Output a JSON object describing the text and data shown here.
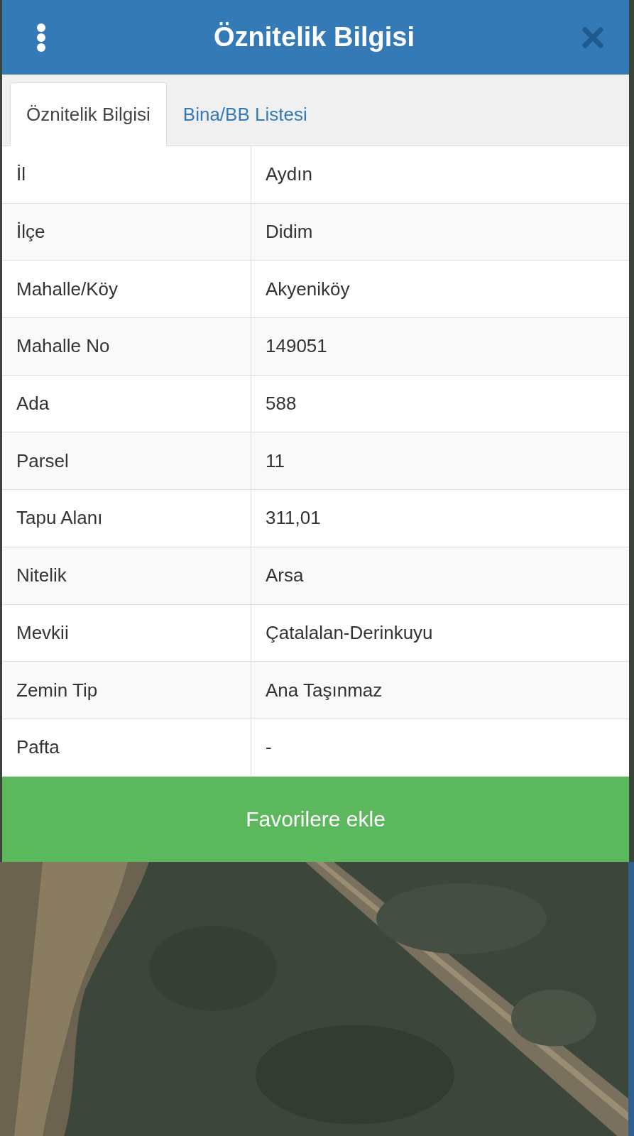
{
  "title": "Öznitelik Bilgisi",
  "tabs": [
    {
      "label": "Öznitelik Bilgisi",
      "selected": true
    },
    {
      "label": "Bina/BB Listesi",
      "selected": false
    }
  ],
  "rows": [
    {
      "label": "İl",
      "value": "Aydın"
    },
    {
      "label": "İlçe",
      "value": "Didim"
    },
    {
      "label": "Mahalle/Köy",
      "value": "Akyeniköy"
    },
    {
      "label": "Mahalle No",
      "value": "149051"
    },
    {
      "label": "Ada",
      "value": "588"
    },
    {
      "label": "Parsel",
      "value": "11"
    },
    {
      "label": "Tapu Alanı",
      "value": "311,01"
    },
    {
      "label": "Nitelik",
      "value": "Arsa"
    },
    {
      "label": "Mevkii",
      "value": "Çatalalan-Derinkuyu"
    },
    {
      "label": "Zemin Tip",
      "value": "Ana Taşınmaz"
    },
    {
      "label": "Pafta",
      "value": "-"
    }
  ],
  "button": "Favorilere ekle"
}
